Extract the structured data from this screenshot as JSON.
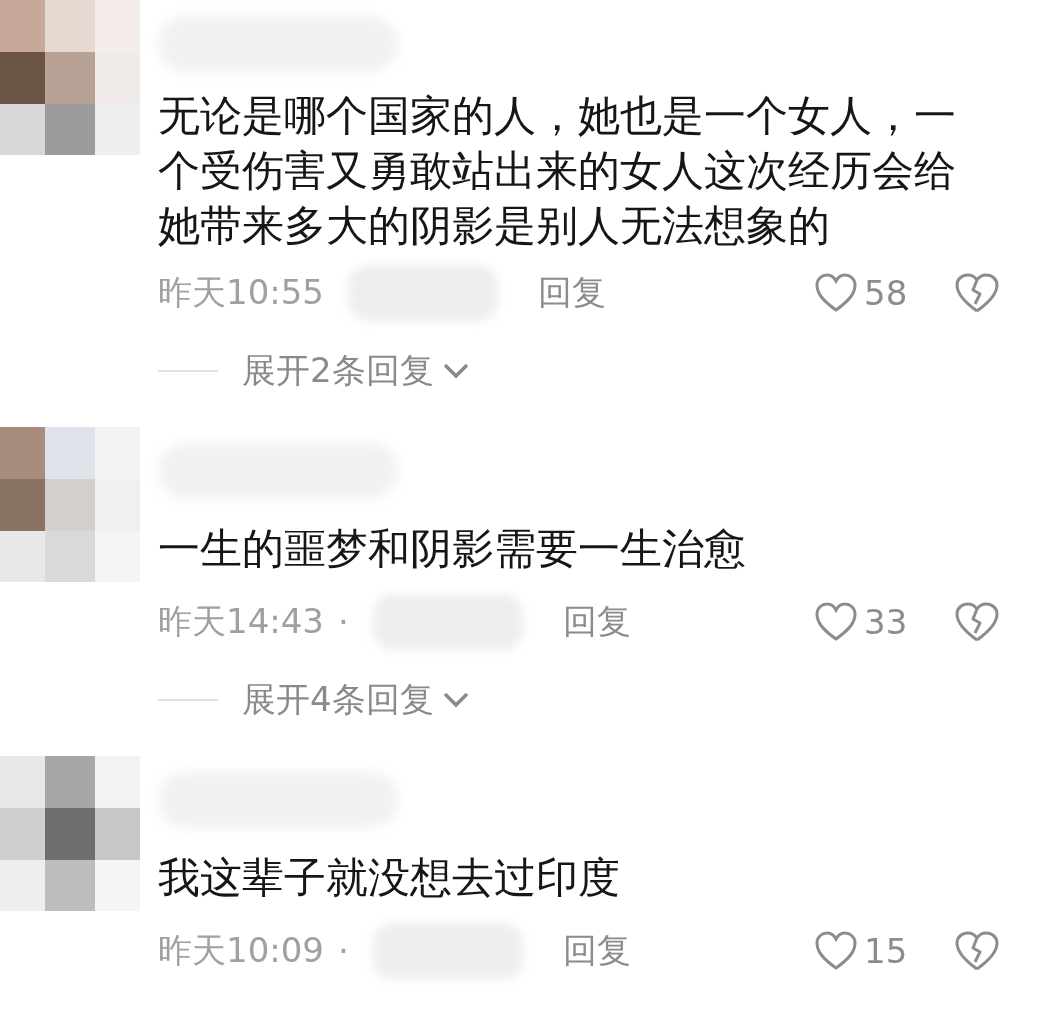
{
  "comments": [
    {
      "text": "无论是哪个国家的人，她也是一个女人，一个受伤害又勇敢站出来的女人这次经历会给她带来多大的阴影是别人无法想象的",
      "time": "昨天10:55",
      "reply": "回复",
      "likes": "58",
      "expand": "展开2条回复"
    },
    {
      "text": "一生的噩梦和阴影需要一生治愈",
      "time": "昨天14:43",
      "separator": "·",
      "reply": "回复",
      "likes": "33",
      "expand": "展开4条回复"
    },
    {
      "text": "我这辈子就没想去过印度",
      "time": "昨天10:09",
      "separator": "·",
      "reply": "回复",
      "likes": "15"
    }
  ]
}
